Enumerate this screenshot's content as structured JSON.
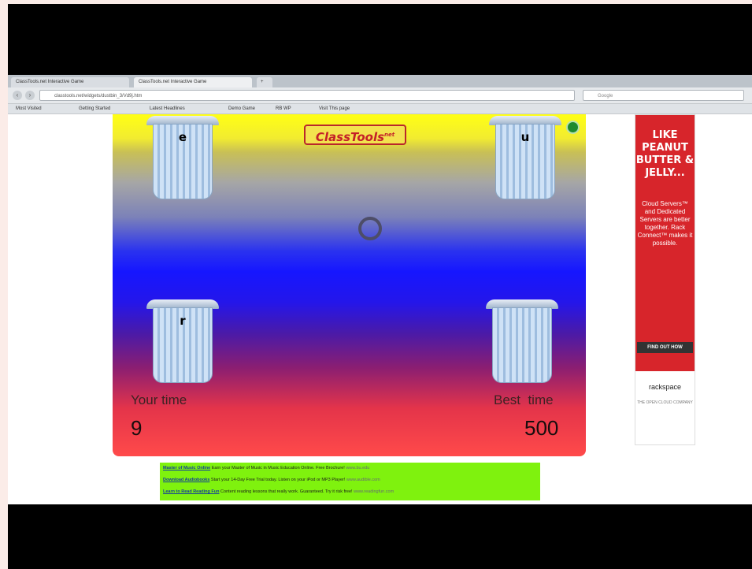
{
  "browser": {
    "tabs": [
      {
        "label": "ClassTools.net Interactive Game"
      },
      {
        "label": "ClassTools.net Interactive Game"
      }
    ],
    "url": "classtools.net/widgets/dustbin_3/Vd9j.htm",
    "search_placeholder": "Google",
    "bookmarks": [
      "Most Visited",
      "Getting Started",
      "Latest Headlines",
      "Demo Game",
      "RB WP",
      "Visit This page"
    ]
  },
  "game": {
    "logo": "ClassTools",
    "logo_suffix": "net",
    "bins": [
      {
        "letter": "e"
      },
      {
        "letter": "u"
      },
      {
        "letter": "r"
      },
      {
        "letter": ""
      }
    ],
    "your_time_label": "Your time",
    "your_time_value": "9",
    "best_time_label": "Best  time",
    "best_time_value": "500"
  },
  "ad": {
    "headline": [
      "LIKE",
      "PEANUT",
      "BUTTER &",
      "JELLY..."
    ],
    "body": "Cloud Servers™ and Dedicated Servers are better together. Rack Connect™ makes it possible.",
    "button": "FIND OUT HOW",
    "logo": "rackspace",
    "sub": "THE OPEN CLOUD COMPANY"
  },
  "ad_links": [
    {
      "title": "Master of Music Online",
      "text": "Earn your Master of Music in Music Education Online. Free Brochure!",
      "url": "www.bu.edu"
    },
    {
      "title": "Download Audiobooks",
      "text": "Start your 14-Day Free Trial today. Listen on your iPod or MP3 Player!",
      "url": "www.audible.com"
    },
    {
      "title": "Learn to Read Reading Fun",
      "text": "Content reading lessons that really work. Guaranteed. Try it risk free!",
      "url": "www.readingfun.com"
    }
  ]
}
